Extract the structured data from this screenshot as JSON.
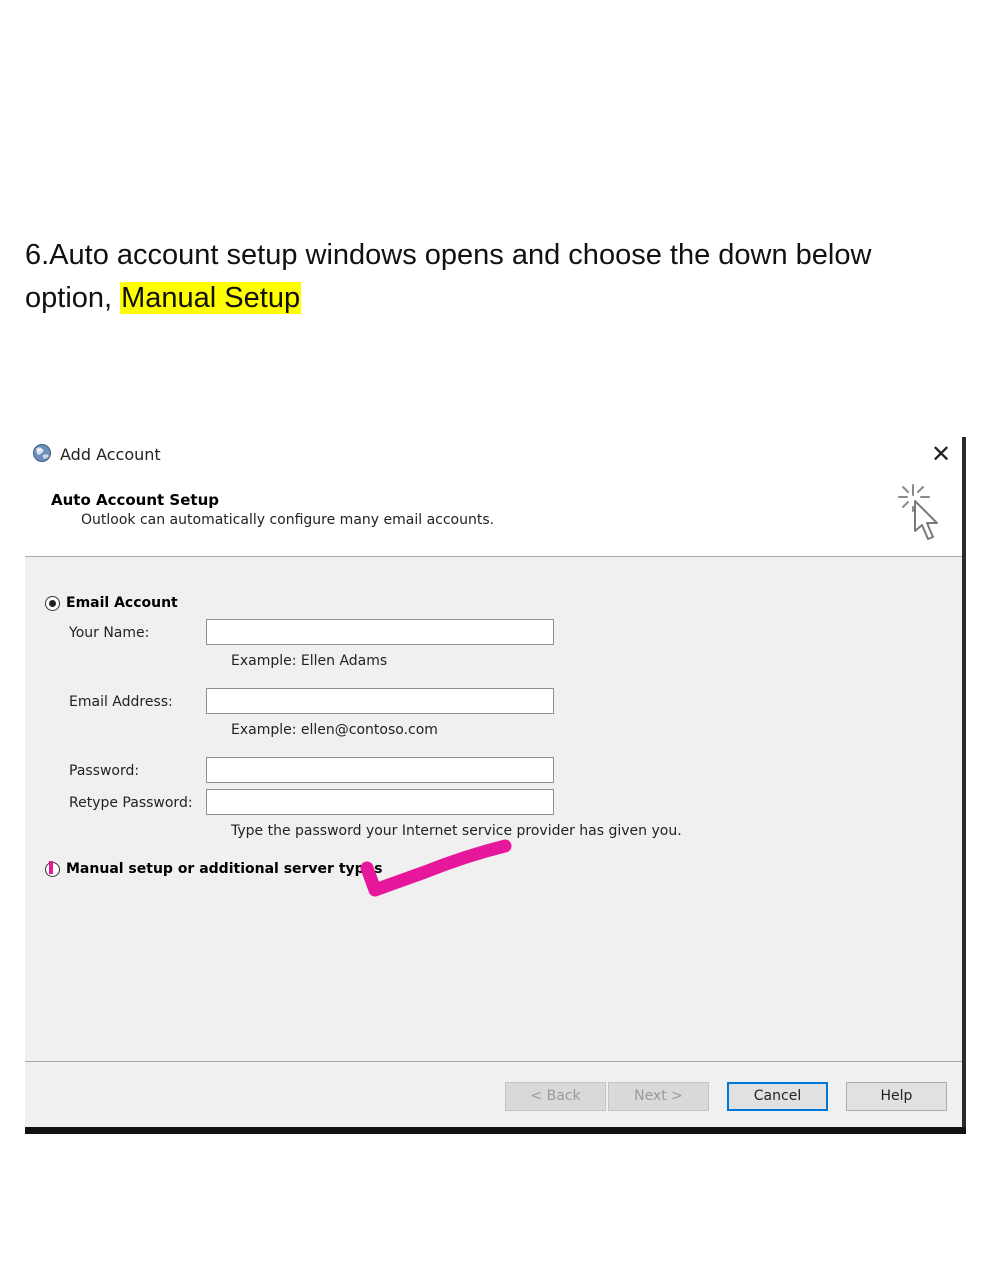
{
  "instruction": {
    "text": "6.Auto account setup windows opens and choose the down below option, ",
    "highlight": "Manual Setup",
    "highlight_color": "#ffff00"
  },
  "dialog": {
    "window_title": "Add Account",
    "close_glyph": "✕",
    "header": {
      "title": "Auto Account Setup",
      "subtitle": "Outlook can automatically configure many email accounts.",
      "icon": "sparkle-cursor-icon"
    },
    "email_account": {
      "label": "Email Account",
      "selected": true,
      "fields": {
        "name": {
          "label": "Your Name:",
          "value": "",
          "hint": "Example: Ellen Adams"
        },
        "email": {
          "label": "Email Address:",
          "value": "",
          "hint": "Example: ellen@contoso.com"
        },
        "password": {
          "label": "Password:",
          "value": ""
        },
        "retype": {
          "label": "Retype Password:",
          "value": "",
          "hint": "Type the password your Internet service provider has given you."
        }
      }
    },
    "manual_setup": {
      "label": "Manual setup or additional server types",
      "selected": false
    },
    "buttons": {
      "back": "< Back",
      "next": "Next >",
      "cancel": "Cancel",
      "help": "Help"
    },
    "accent_color": "#0078d7",
    "annotation_color": "#e6179a"
  }
}
